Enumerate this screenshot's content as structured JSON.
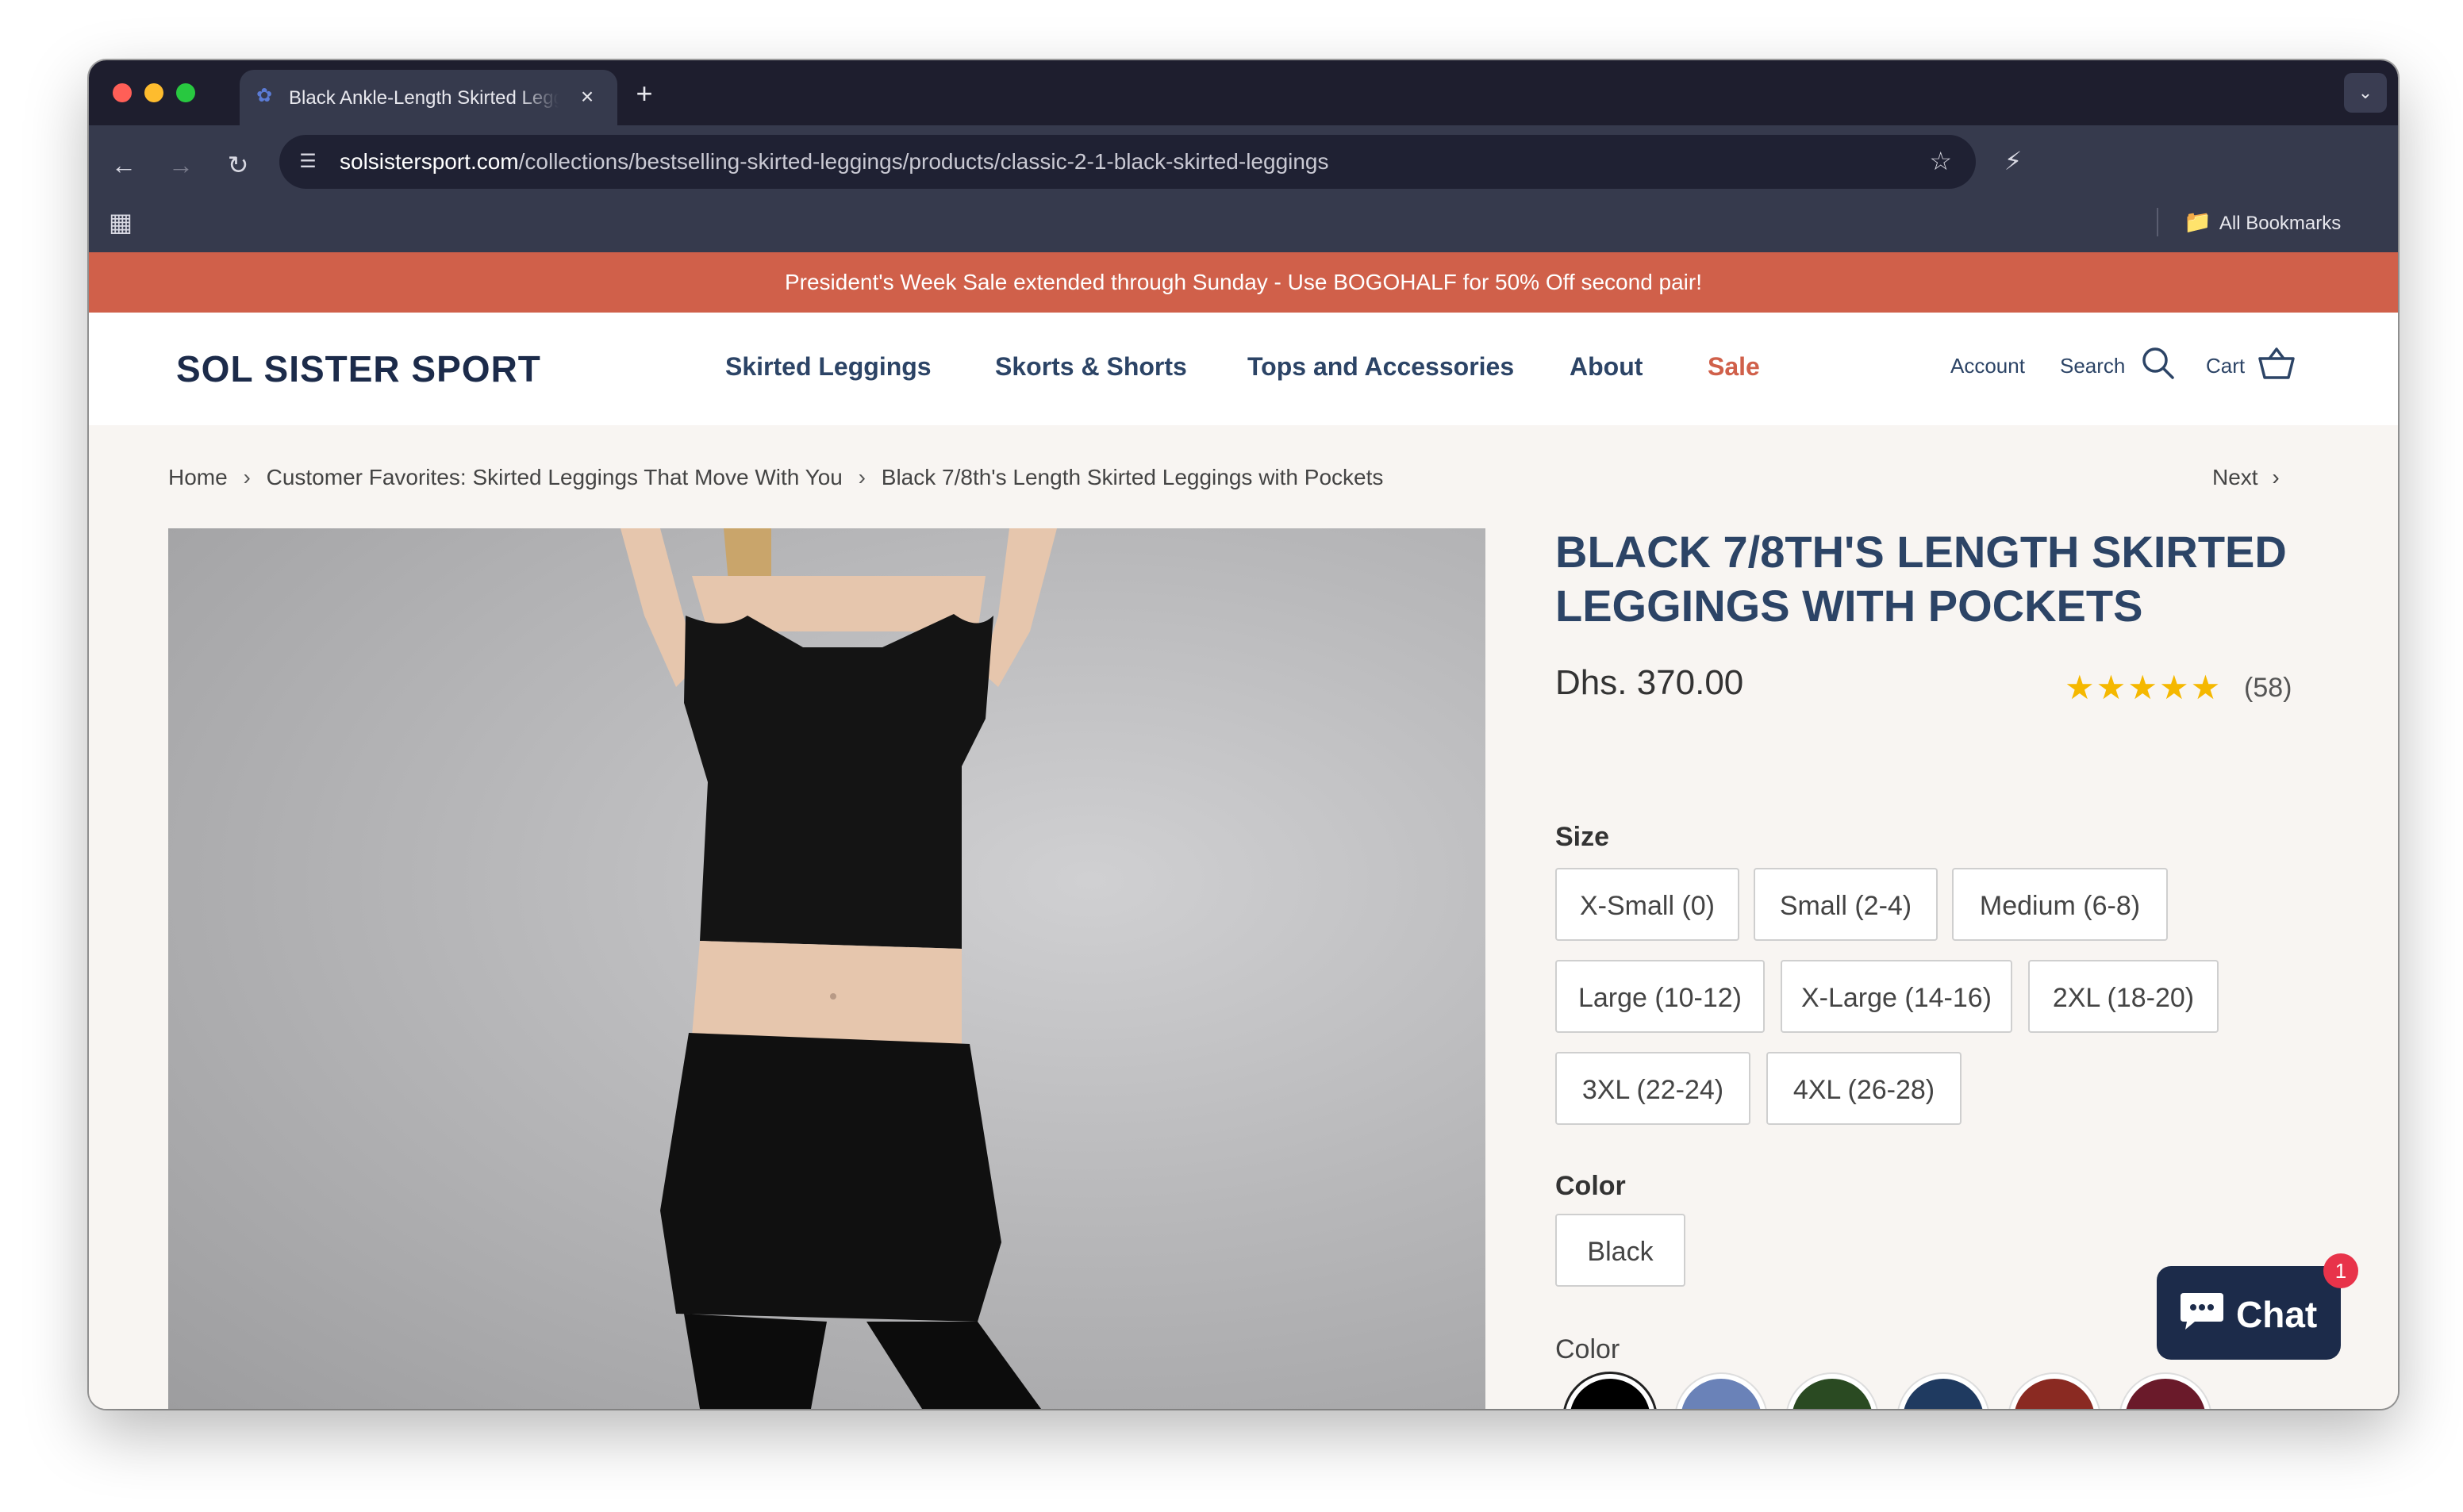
{
  "browser": {
    "tab_title": "Black Ankle-Length Skirted Leggings",
    "url_host": "solsistersport.com",
    "url_path": "/collections/bestselling-skirted-leggings/products/classic-2-1-black-skirted-leggings",
    "bookmarks_label": "All Bookmarks"
  },
  "promo_banner": "President's Week Sale extended through Sunday - Use BOGOHALF for 50% Off second pair!",
  "header": {
    "logo": "SOL SISTER SPORT",
    "nav": [
      "Skirted Leggings",
      "Skorts & Shorts",
      "Tops and Accessories",
      "About",
      "Sale"
    ],
    "account": "Account",
    "search": "Search",
    "cart": "Cart"
  },
  "breadcrumb": {
    "home": "Home",
    "collection": "Customer Favorites: Skirted Leggings That Move With You",
    "product": "Black 7/8th's Length Skirted Leggings with Pockets",
    "next": "Next"
  },
  "product": {
    "title": "BLACK 7/8TH'S LENGTH SKIRTED LEGGINGS WITH POCKETS",
    "price": "Dhs. 370.00",
    "rating": 5,
    "review_count": "(58)",
    "size_label": "Size",
    "sizes": [
      "X-Small (0)",
      "Small (2-4)",
      "Medium (6-8)",
      "Large (10-12)",
      "X-Large (14-16)",
      "2XL (18-20)",
      "3XL (22-24)",
      "4XL (26-28)"
    ],
    "color_label": "Color",
    "color_value": "Black",
    "color_label_2": "Color",
    "swatches": [
      "#000000",
      "#6a82b8",
      "#2a4a22",
      "#1f3a60",
      "#8a2a22",
      "#6a1a2a"
    ]
  },
  "chat": {
    "label": "Chat",
    "badge": "1"
  },
  "colors": {
    "brand_navy": "#2c4466",
    "promo_orange": "#d0604a",
    "star_gold": "#f5b800"
  }
}
